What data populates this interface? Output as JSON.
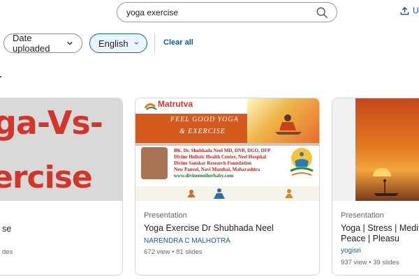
{
  "search": {
    "value": "yoga exercise",
    "placeholder": ""
  },
  "header": {
    "upload_label": "Up"
  },
  "filters": {
    "date_label": "Date uploaded",
    "language_label": "English",
    "clear_label": "Clear all"
  },
  "cards": [
    {
      "thumb_line1": "ga-Vs-",
      "thumb_line2": "ercise",
      "type": "",
      "title": "se",
      "author": "",
      "meta": "des"
    },
    {
      "thumb_logo": "Matrutva",
      "thumb_banner_line1": "FEEL GOOD YOGA",
      "thumb_banner_line2": "& EXERCISE",
      "thumb_info": [
        "BK. Dr. Shubhada Neel  MD, DNB, DGO, DFP",
        "Divine Holistic Health Centre, Neel Hospital",
        "Divine Sanskar Research Foundation",
        "New Panvel, Navi Mumbai, Maharashtra",
        "www.divinemotherbaby.com"
      ],
      "type": "Presentation",
      "title": "Yoga  Exercise  Dr Shubhada Neel",
      "author": "NARENDRA C MALHOTRA",
      "meta": "672 view  •  81 slides"
    },
    {
      "type": "Presentation",
      "title_line1": "Yoga | Stress | Medita",
      "title_line2": "Peace | Pleasu",
      "author": "yogisri",
      "meta": "937 view  •  39 slides"
    }
  ],
  "colors": {
    "accent": "#0a5f8f",
    "selected_chip_bg": "#eaf6fb",
    "title_red": "#d2352a"
  }
}
